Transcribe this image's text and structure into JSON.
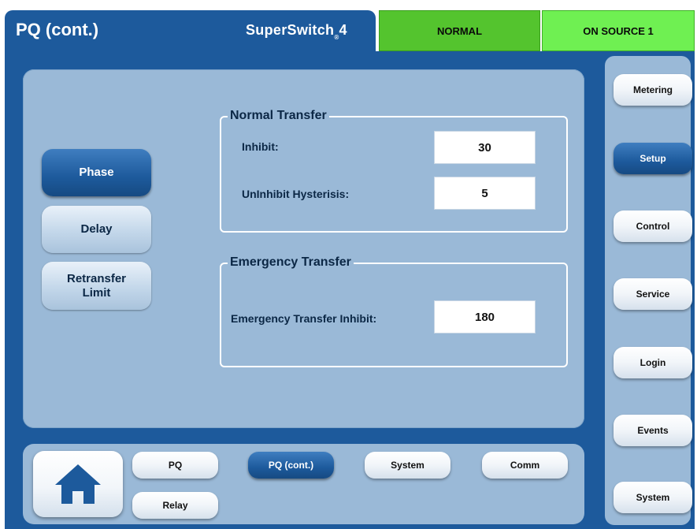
{
  "header": {
    "title": "PQ (cont.)",
    "brand": "SuperSwitch",
    "brand_sup": "®",
    "brand_suffix": "4",
    "status_normal": "NORMAL",
    "status_source": "ON SOURCE 1",
    "colors": {
      "header_bg": "#1d5a9c",
      "normal_bg": "#54c42e",
      "source_bg": "#6ff052"
    }
  },
  "left_tabs": [
    {
      "label": "Phase",
      "active": true
    },
    {
      "label": "Delay",
      "active": false
    },
    {
      "label": "Retransfer Limit",
      "active": false
    }
  ],
  "normal_transfer": {
    "legend": "Normal Transfer",
    "inhibit_label": "Inhibit:",
    "inhibit_value": "30",
    "uninhibit_label": "UnInhibit Hysterisis:",
    "uninhibit_value": "5"
  },
  "emergency_transfer": {
    "legend": "Emergency Transfer",
    "inhibit_label": "Emergency Transfer Inhibit:",
    "inhibit_value": "180"
  },
  "side_nav": [
    {
      "label": "Metering",
      "active": false
    },
    {
      "label": "Setup",
      "active": true
    },
    {
      "label": "Control",
      "active": false
    },
    {
      "label": "Service",
      "active": false
    },
    {
      "label": "Login",
      "active": false
    },
    {
      "label": "Events",
      "active": false
    },
    {
      "label": "System",
      "active": false
    }
  ],
  "bottom_nav": {
    "home_icon": "home-icon",
    "items": [
      {
        "label": "PQ",
        "active": false
      },
      {
        "label": "PQ (cont.)",
        "active": true
      },
      {
        "label": "System",
        "active": false
      },
      {
        "label": "Comm",
        "active": false
      },
      {
        "label": "Relay",
        "active": false
      }
    ]
  }
}
